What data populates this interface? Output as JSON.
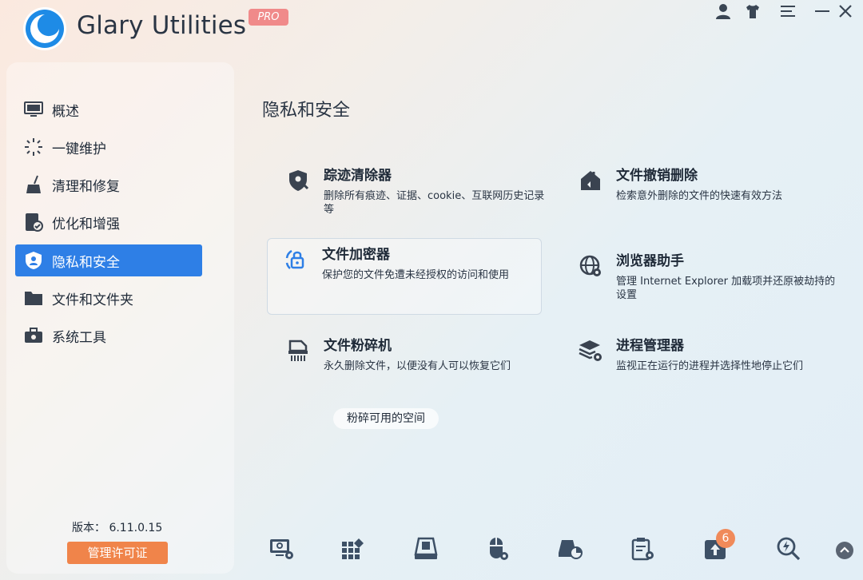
{
  "app": {
    "name": "Glary Utilities",
    "badge": "PRO"
  },
  "window_controls": [
    "user-icon",
    "shirt-skin-icon",
    "menu-icon",
    "minimize-icon",
    "close-icon"
  ],
  "sidebar": {
    "items": [
      {
        "label": "概述",
        "icon": "monitor-icon",
        "active": false
      },
      {
        "label": "一键维护",
        "icon": "spark-icon",
        "active": false
      },
      {
        "label": "清理和修复",
        "icon": "broom-icon",
        "active": false
      },
      {
        "label": "优化和增强",
        "icon": "speed-check-icon",
        "active": false
      },
      {
        "label": "隐私和安全",
        "icon": "shield-user-icon",
        "active": true
      },
      {
        "label": "文件和文件夹",
        "icon": "folder-icon",
        "active": false
      },
      {
        "label": "系统工具",
        "icon": "toolbox-icon",
        "active": false
      }
    ],
    "version_label": "版本：",
    "version_value": "6.11.0.15",
    "license_button": "管理许可证"
  },
  "main": {
    "title": "隐私和安全",
    "cards": [
      {
        "title": "踪迹清除器",
        "desc": "删除所有痕迹、证据、cookie、互联网历史记录等",
        "icon": "shield-eraser-icon"
      },
      {
        "title": "文件撤销删除",
        "desc": "检索意外删除的文件的快速有效方法",
        "icon": "undelete-house-icon"
      },
      {
        "title": "文件加密器",
        "desc": "保护您的文件免遭未经授权的访问和使用",
        "icon": "lock-encrypt-icon"
      },
      {
        "title": "浏览器助手",
        "desc": "管理 Internet Explorer 加载项并还原被劫持的设置",
        "icon": "globe-gear-icon"
      },
      {
        "title": "文件粉碎机",
        "desc": "永久删除文件，以便没有人可以恢复它们",
        "icon": "shredder-icon"
      },
      {
        "title": "进程管理器",
        "desc": "监视正在运行的进程并选择性地停止它们",
        "icon": "layers-gear-icon"
      }
    ],
    "space_button": "粉碎可用的空间"
  },
  "toolbar": {
    "icons": [
      "monitor-gear-icon",
      "apps-grid-icon",
      "disk-icon",
      "mouse-gear-icon",
      "pie-disk-icon",
      "clipboard-gear-icon",
      "upload-icon",
      "magnify-bolt-icon"
    ],
    "update_count": "6"
  },
  "colors": {
    "accent": "#2e7fe6",
    "license": "#f0844a",
    "pro": "#f08a8a"
  }
}
